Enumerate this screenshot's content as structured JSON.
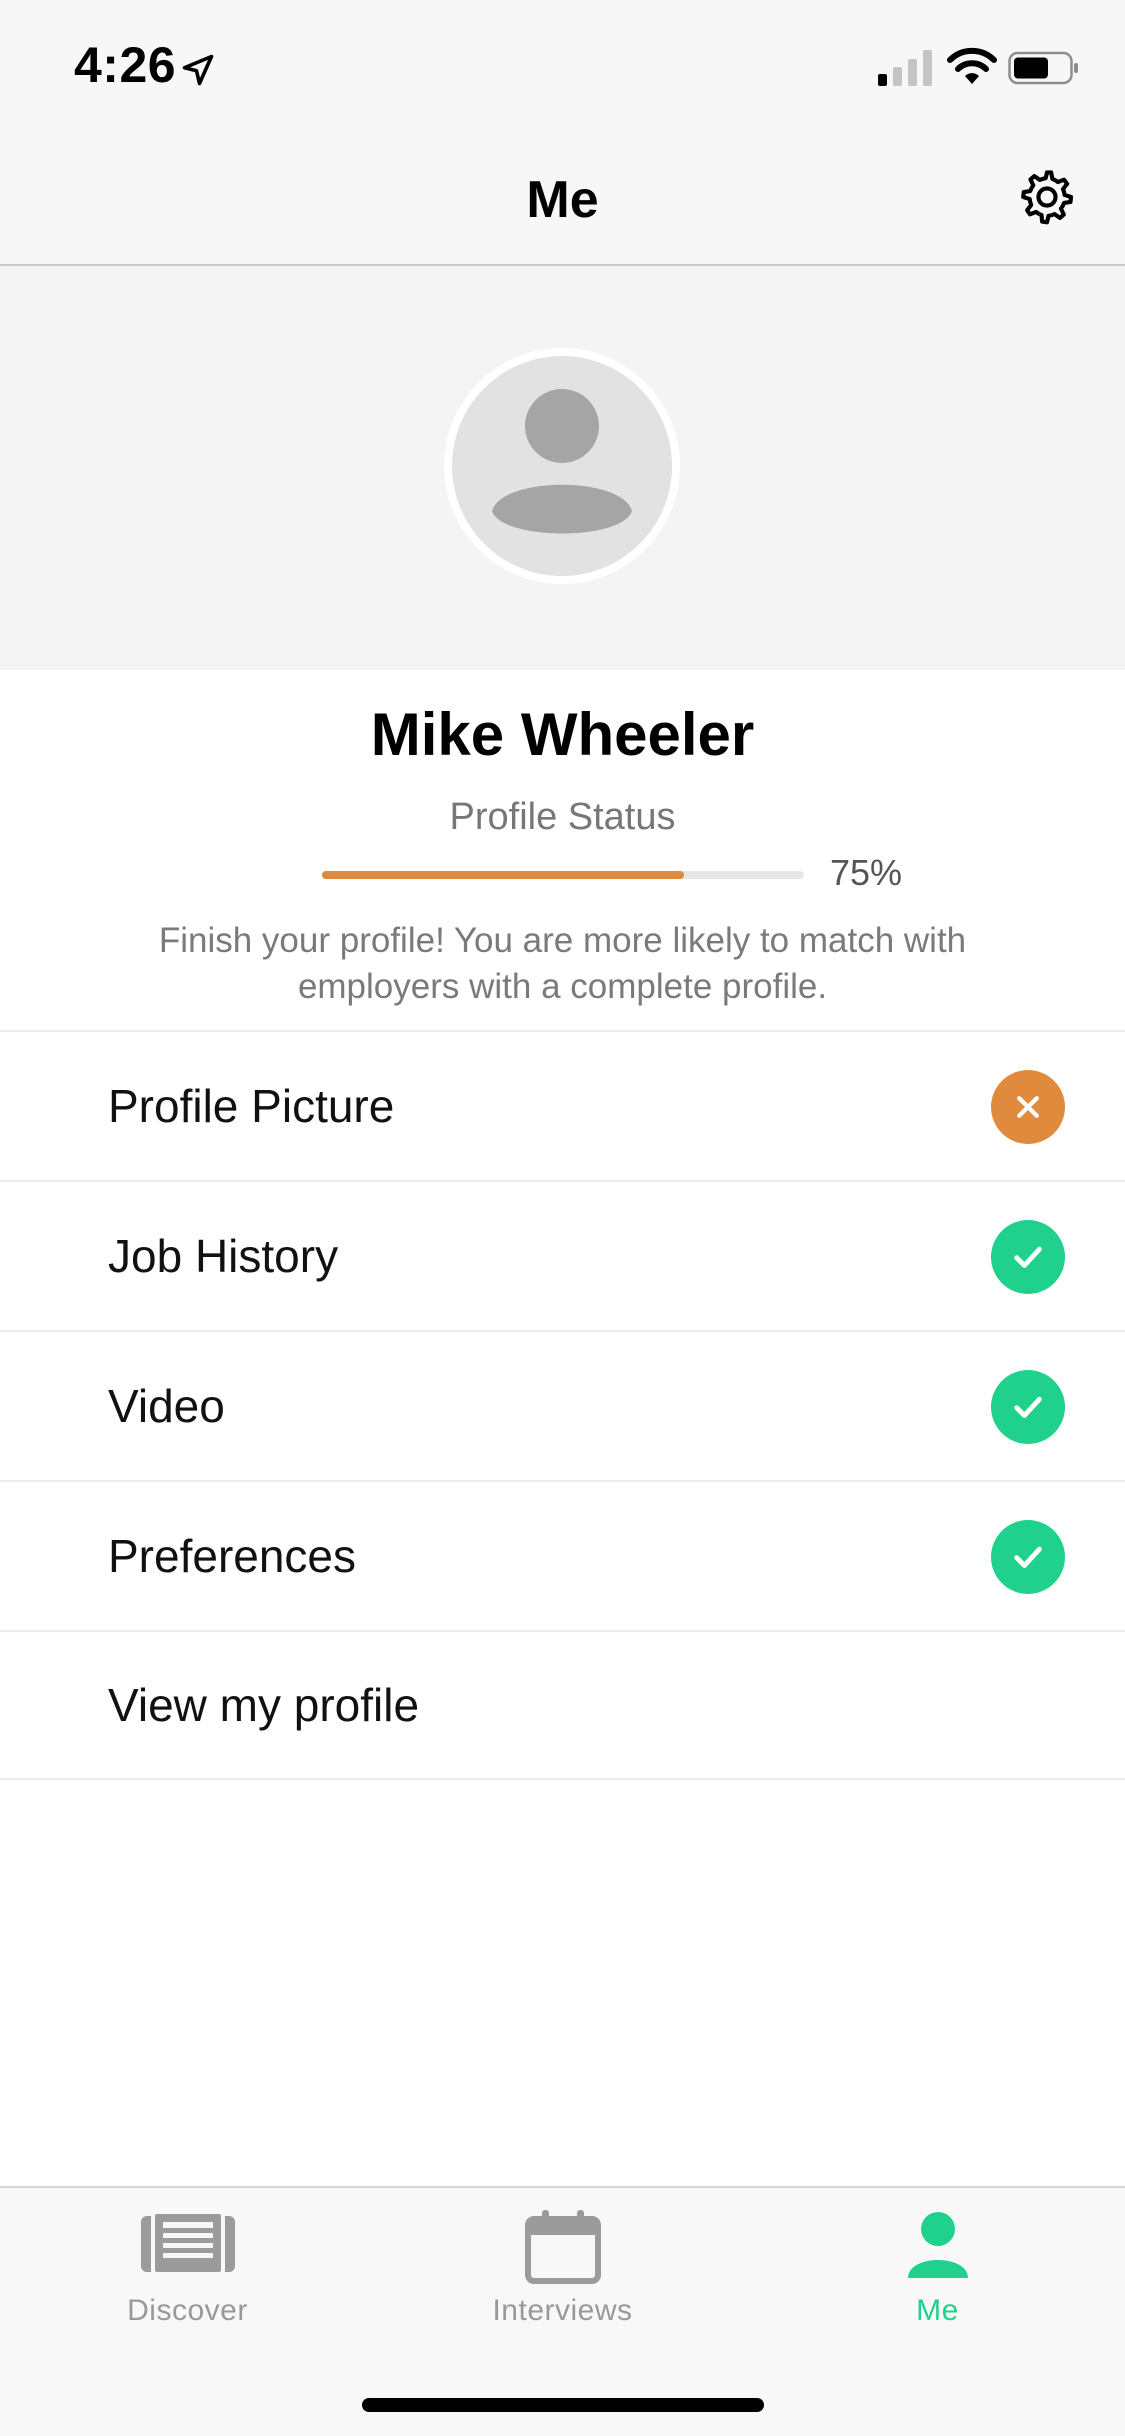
{
  "status_bar": {
    "time": "4:26"
  },
  "nav": {
    "title": "Me",
    "settings_icon": "gear-icon"
  },
  "profile": {
    "name": "Mike Wheeler",
    "status_label": "Profile Status",
    "progress_percent": 75,
    "progress_text": "75%",
    "hint": "Finish your profile! You are more likely to match with employers with a complete profile."
  },
  "checklist": [
    {
      "label": "Profile Picture",
      "state": "incomplete",
      "icon": "x-icon"
    },
    {
      "label": "Job History",
      "state": "complete",
      "icon": "check-icon"
    },
    {
      "label": "Video",
      "state": "complete",
      "icon": "check-icon"
    },
    {
      "label": "Preferences",
      "state": "complete",
      "icon": "check-icon"
    },
    {
      "label": "View my profile",
      "state": "link",
      "icon": ""
    }
  ],
  "tabs": [
    {
      "label": "Discover",
      "icon": "newspaper-icon",
      "active": false
    },
    {
      "label": "Interviews",
      "icon": "calendar-icon",
      "active": false
    },
    {
      "label": "Me",
      "icon": "person-icon",
      "active": true
    }
  ],
  "colors": {
    "accent_green": "#1fd18c",
    "accent_orange": "#e08a3e",
    "inactive_gray": "#999999"
  }
}
